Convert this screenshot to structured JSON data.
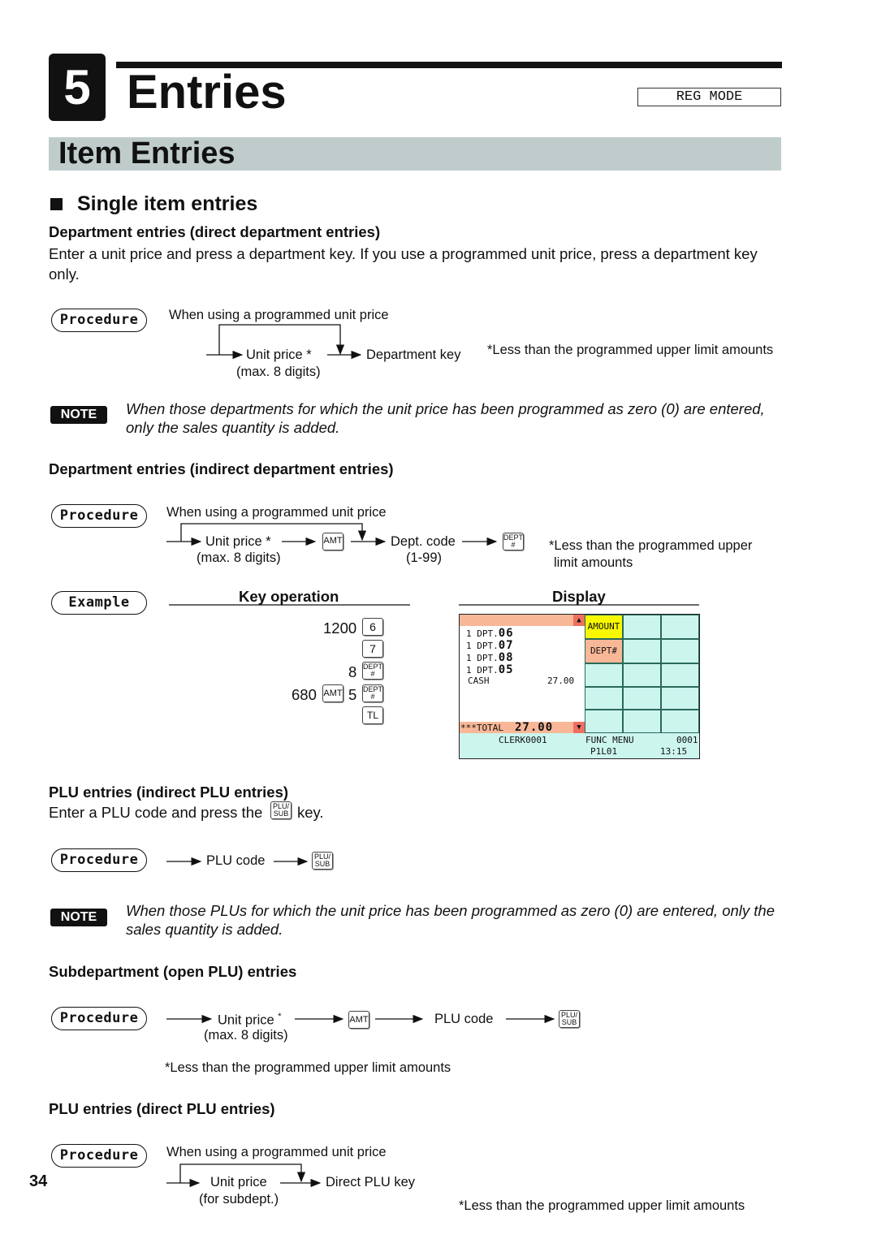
{
  "chapter": {
    "number": "5",
    "title": "Entries",
    "mode": "REG MODE"
  },
  "section": "Item Entries",
  "subsection": "Single item entries",
  "direct_dept": {
    "heading": "Department entries (direct department entries)",
    "text": "Enter a unit price and press a department key.  If you use a programmed unit price, press a department key only.",
    "procedure": "Procedure",
    "loop_label": "When using a programmed unit price",
    "unit_price": "Unit price *",
    "max_digits": "(max. 8 digits)",
    "dept_key": "Department key",
    "footnote": "*Less than the programmed upper limit amounts"
  },
  "note1": {
    "badge": "NOTE",
    "text": "When those departments for which the unit price has been programmed as zero (0) are entered, only the sales quantity is added."
  },
  "indirect_dept": {
    "heading": "Department entries (indirect department entries)",
    "procedure": "Procedure",
    "loop_label": "When using a programmed unit price",
    "unit_price": "Unit price *",
    "max_digits": "(max. 8 digits)",
    "amt_key": "AMT",
    "dept_code": "Dept. code",
    "code_range": "(1-99)",
    "dept_key": "DEPT #",
    "footnote_1": "*Less than the programmed upper",
    "footnote_2": "limit amounts"
  },
  "example": {
    "label": "Example",
    "key_op_heading": "Key operation",
    "display_heading": "Display",
    "keys": {
      "v1200": "1200",
      "k6": "6",
      "k7": "7",
      "v8": "8",
      "dept": "DEPT #",
      "v680": "680",
      "amt": "AMT",
      "v5": "5",
      "tl": "TL"
    },
    "display": {
      "rows": [
        {
          "q": "1 DPT.",
          "d": "06"
        },
        {
          "q": "1 DPT.",
          "d": "07"
        },
        {
          "q": "1 DPT.",
          "d": "08"
        },
        {
          "q": "1 DPT.",
          "d": "05"
        }
      ],
      "cash_label": "CASH",
      "cash_value": "27.00",
      "total_label": "***TOTAL",
      "total_value": "27.00",
      "amount_btn": "AMOUNT",
      "dept_btn": "DEPT#",
      "clerk": "CLERK0001",
      "func_menu": "FUNC MENU",
      "counter": "0001",
      "pl": "P1L01",
      "time": "13:15",
      "colors": {
        "bar": "#f8b898",
        "amount": "#f8f800",
        "panel": "#ccf5ee"
      }
    }
  },
  "plu_indirect": {
    "heading": "PLU entries (indirect PLU entries)",
    "text_pre": "Enter a PLU code and press the",
    "text_post": "key.",
    "plu_key": "PLU/ SUB",
    "procedure": "Procedure",
    "plu_code": "PLU code"
  },
  "note2": {
    "badge": "NOTE",
    "text": "When those PLUs for which the unit price has been programmed as zero (0) are entered, only the sales quantity is added."
  },
  "subdept": {
    "heading": "Subdepartment (open PLU) entries",
    "procedure": "Procedure",
    "unit_price": "Unit price",
    "star": "*",
    "max_digits": "(max. 8 digits)",
    "amt_key": "AMT",
    "plu_code": "PLU code",
    "plu_key": "PLU/ SUB",
    "footnote": "*Less than the programmed upper limit amounts"
  },
  "plu_direct": {
    "heading": "PLU entries (direct PLU entries)",
    "procedure": "Procedure",
    "loop_label": "When using a programmed unit price",
    "unit_price": "Unit price",
    "for_subdept": "(for subdept.)",
    "direct_key": "Direct PLU key",
    "footnote": "*Less than the programmed upper limit amounts"
  },
  "page_number": "34"
}
